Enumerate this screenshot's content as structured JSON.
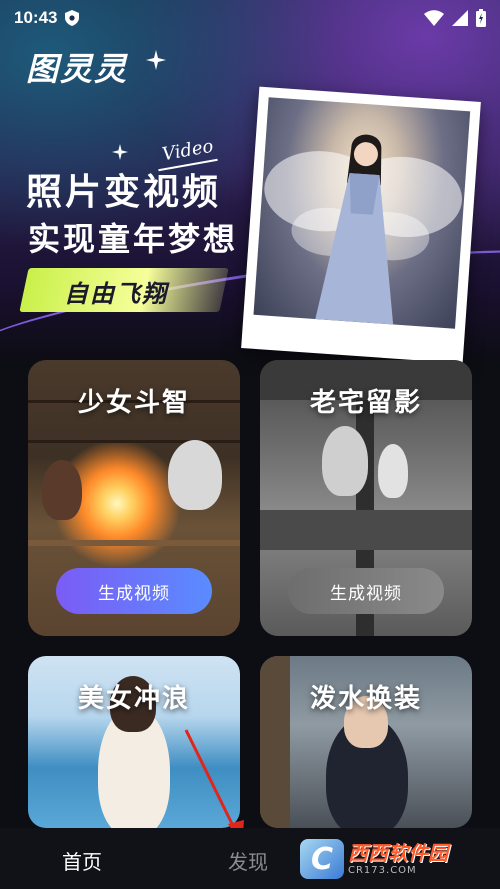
{
  "status_bar": {
    "time": "10:43"
  },
  "header": {
    "logo": "图灵灵",
    "video_tag": "Video",
    "headline_line1": "照片变视频",
    "headline_line2": "实现童年梦想",
    "banner": "自由飞翔"
  },
  "cards": [
    {
      "title": "少女斗智",
      "button": "生成视频"
    },
    {
      "title": "老宅留影",
      "button": "生成视频"
    },
    {
      "title": "美女冲浪"
    },
    {
      "title": "泼水换装"
    }
  ],
  "bottom_nav": {
    "home": "首页",
    "discover": "发现"
  },
  "watermark": {
    "letter": "C",
    "main": "西西软件园",
    "sub": "CR173.COM"
  },
  "colors": {
    "button_gradient_start": "#7b5cf5",
    "button_gradient_end": "#5a8cff",
    "banner_yellow": "#c9f04a",
    "nav_active": "#ffffff",
    "nav_inactive": "#8a8a90",
    "annotation_arrow": "#e0261b"
  }
}
